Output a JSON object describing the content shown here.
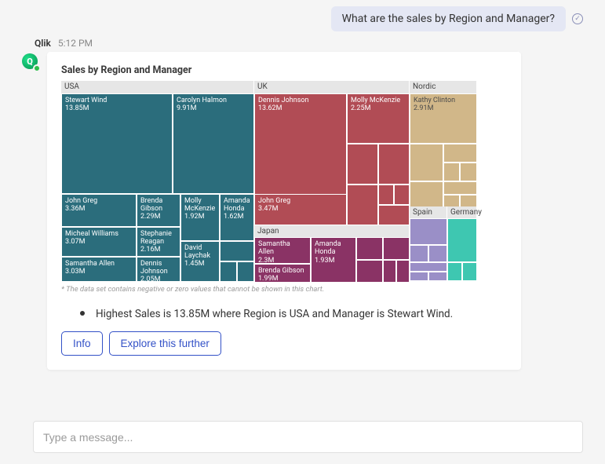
{
  "user_message": "What are the sales by Region and Manager?",
  "sender": {
    "name": "Qlik",
    "time": "5:12 PM"
  },
  "avatar": {
    "letter": "Q"
  },
  "chart_title": "Sales by Region and Manager",
  "footnote": "* The data set contains negative or zero values that cannot be shown in this chart.",
  "insight": "Highest Sales is 13.85M where Region is USA and Manager is Stewart Wind.",
  "buttons": {
    "info": "Info",
    "explore": "Explore this further"
  },
  "composer_placeholder": "Type a message...",
  "regions": {
    "usa": "USA",
    "uk": "UK",
    "japan": "Japan",
    "nordic": "Nordic",
    "spain": "Spain",
    "germany": "Germany"
  },
  "chart_data": {
    "type": "treemap",
    "title": "Sales by Region and Manager",
    "unit": "M",
    "hierarchy": [
      "Region",
      "Manager"
    ],
    "series": [
      {
        "name": "USA",
        "children": [
          {
            "name": "Stewart Wind",
            "value": 13.85
          },
          {
            "name": "Carolyn Halmon",
            "value": 9.91
          },
          {
            "name": "John Greg",
            "value": 3.36
          },
          {
            "name": "Brenda Gibson",
            "value": 2.29
          },
          {
            "name": "Molly McKenzie",
            "value": 1.92
          },
          {
            "name": "Amanda Honda",
            "value": 1.62
          },
          {
            "name": "Micheal Williams",
            "value": 3.07
          },
          {
            "name": "Stephanie Reagan",
            "value": 2.16
          },
          {
            "name": "David Laychak",
            "value": 1.45
          },
          {
            "name": "Samantha Allen",
            "value": 3.03
          },
          {
            "name": "Dennis Johnson",
            "value": 2.05
          }
        ]
      },
      {
        "name": "UK",
        "children": [
          {
            "name": "Dennis Johnson",
            "value": 13.62
          },
          {
            "name": "Molly McKenzie",
            "value": 2.25
          },
          {
            "name": "John Greg",
            "value": 3.47
          }
        ]
      },
      {
        "name": "Japan",
        "children": [
          {
            "name": "Samantha Allen",
            "value": 2.3
          },
          {
            "name": "Amanda Honda",
            "value": 1.93
          },
          {
            "name": "Brenda Gibson",
            "value": 1.99
          }
        ]
      },
      {
        "name": "Nordic",
        "children": [
          {
            "name": "Kathy Clinton",
            "value": 2.91
          }
        ]
      },
      {
        "name": "Spain",
        "children": []
      },
      {
        "name": "Germany",
        "children": []
      }
    ]
  }
}
